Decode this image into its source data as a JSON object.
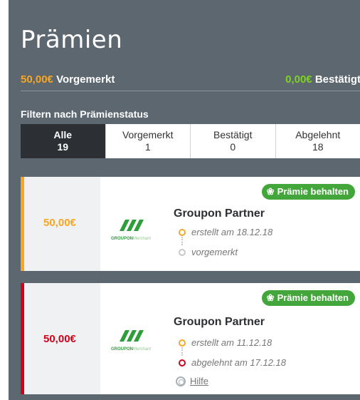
{
  "page": {
    "title": "Prämien"
  },
  "summary": {
    "pending_amount": "50,00€",
    "pending_label": "Vorgemerkt",
    "confirmed_amount": "0,00€",
    "confirmed_label": "Bestätigt"
  },
  "filter": {
    "label": "Filtern nach Prämienstatus",
    "tabs": [
      {
        "label": "Alle",
        "count": "19",
        "active": true
      },
      {
        "label": "Vorgemerkt",
        "count": "1",
        "active": false
      },
      {
        "label": "Bestätigt",
        "count": "0",
        "active": false
      },
      {
        "label": "Abgelehnt",
        "count": "18",
        "active": false
      }
    ]
  },
  "rewards": [
    {
      "amount": "50,00€",
      "status_color": "#f6a623",
      "badge": "Prämie behalten",
      "badge_icon": "award-icon",
      "partner": "Groupon Partner",
      "logo_text": "GROUPON",
      "logo_subtext": "Merchant",
      "steps": [
        {
          "text": "erstellt am 18.12.18",
          "state": "done"
        },
        {
          "text": "vorgemerkt",
          "state": "pending"
        }
      ]
    },
    {
      "amount": "50,00€",
      "status_color": "#d0021b",
      "badge": "Prämie behalten",
      "badge_icon": "award-icon",
      "partner": "Groupon Partner",
      "logo_text": "GROUPON",
      "logo_subtext": "Merchant",
      "steps": [
        {
          "text": "erstellt am 11.12.18",
          "state": "done"
        },
        {
          "text": "abgelehnt am 17.12.18",
          "state": "rejected"
        }
      ],
      "help_label": "Hilfe",
      "help_icon": "lifebuoy-icon"
    }
  ],
  "colors": {
    "panel_bg": "#5d6770",
    "accent_orange": "#f6a623",
    "accent_green": "#7ed321",
    "badge_green": "#43a63a",
    "reject_red": "#d0021b",
    "groupon_green": "#2e9e3a"
  }
}
